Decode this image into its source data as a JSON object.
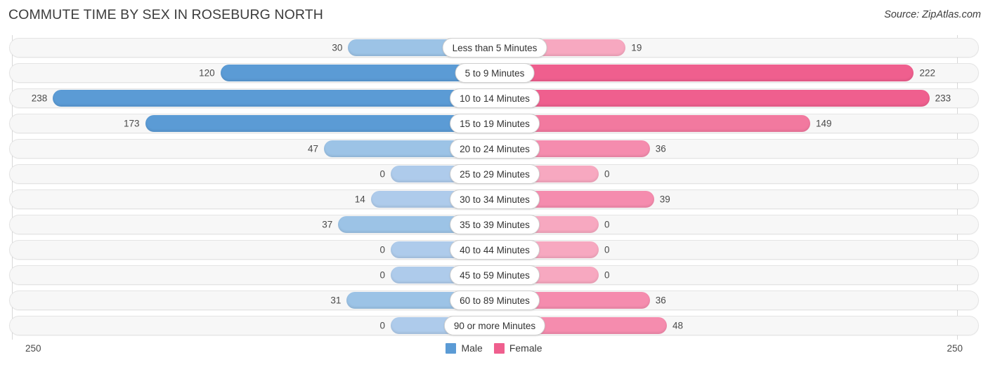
{
  "header": {
    "title": "COMMUTE TIME BY SEX IN ROSEBURG NORTH",
    "source": "Source: ZipAtlas.com"
  },
  "axis": {
    "left_label": "250",
    "right_label": "250"
  },
  "legend": {
    "items": [
      {
        "label": "Male",
        "color": "#5b9bd5"
      },
      {
        "label": "Female",
        "color": "#ef5f8e"
      }
    ]
  },
  "colors": {
    "male_strong": "#5b9bd5",
    "male_light": "#aecbeb",
    "female_strong": "#ef5f8e",
    "female_mid": "#f2799f",
    "female_light": "#f7a8c0",
    "track_bg": "#f7f7f7",
    "track_border": "#e4e4e4",
    "gridline": "#d8d8d8",
    "text": "#3a3a3a"
  },
  "chart_data": {
    "type": "bar",
    "subtype": "diverging-bidirectional-bar",
    "title": "COMMUTE TIME BY SEX IN ROSEBURG NORTH",
    "xlabel": "",
    "ylabel": "",
    "axis_max": 250,
    "xlim": [
      250,
      250
    ],
    "grid": true,
    "legend_position": "bottom-center",
    "categories": [
      "Less than 5 Minutes",
      "5 to 9 Minutes",
      "10 to 14 Minutes",
      "15 to 19 Minutes",
      "20 to 24 Minutes",
      "25 to 29 Minutes",
      "30 to 34 Minutes",
      "35 to 39 Minutes",
      "40 to 44 Minutes",
      "45 to 59 Minutes",
      "60 to 89 Minutes",
      "90 or more Minutes"
    ],
    "series": [
      {
        "name": "Male",
        "direction": "left",
        "values": [
          30,
          120,
          238,
          173,
          47,
          0,
          14,
          37,
          0,
          0,
          31,
          0
        ]
      },
      {
        "name": "Female",
        "direction": "right",
        "values": [
          19,
          222,
          233,
          149,
          36,
          0,
          39,
          0,
          0,
          0,
          36,
          48
        ]
      }
    ]
  },
  "rows": [
    {
      "label": "Less than 5 Minutes",
      "male": "30",
      "female": "19"
    },
    {
      "label": "5 to 9 Minutes",
      "male": "120",
      "female": "222"
    },
    {
      "label": "10 to 14 Minutes",
      "male": "238",
      "female": "233"
    },
    {
      "label": "15 to 19 Minutes",
      "male": "173",
      "female": "149"
    },
    {
      "label": "20 to 24 Minutes",
      "male": "47",
      "female": "36"
    },
    {
      "label": "25 to 29 Minutes",
      "male": "0",
      "female": "0"
    },
    {
      "label": "30 to 34 Minutes",
      "male": "14",
      "female": "39"
    },
    {
      "label": "35 to 39 Minutes",
      "male": "37",
      "female": "0"
    },
    {
      "label": "40 to 44 Minutes",
      "male": "0",
      "female": "0"
    },
    {
      "label": "45 to 59 Minutes",
      "male": "0",
      "female": "0"
    },
    {
      "label": "60 to 89 Minutes",
      "male": "31",
      "female": "36"
    },
    {
      "label": "90 or more Minutes",
      "male": "0",
      "female": "48"
    }
  ]
}
